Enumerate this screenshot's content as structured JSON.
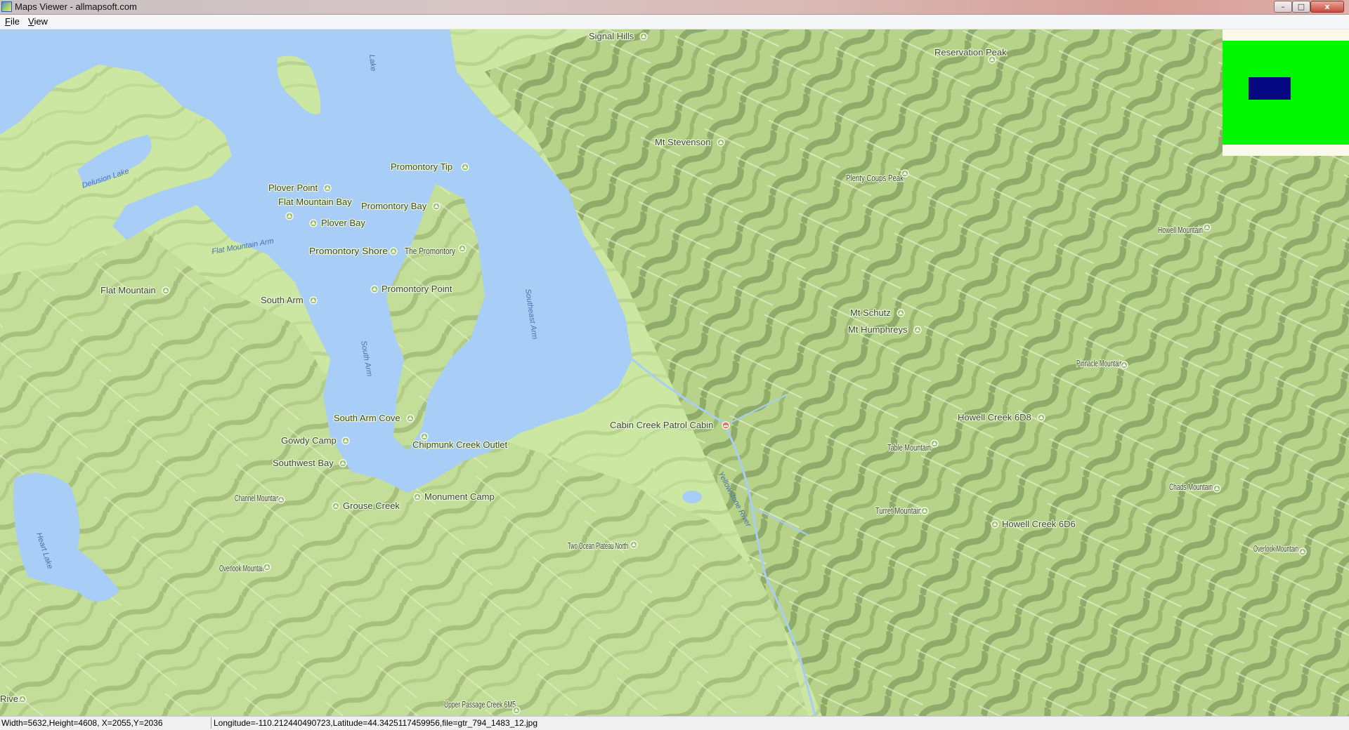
{
  "window": {
    "title": "Maps Viewer - allmapsoft.com",
    "buttons": {
      "minimize": "–",
      "maximize": "□",
      "close": "x"
    }
  },
  "menu": {
    "file": "File",
    "view": "View"
  },
  "map": {
    "water_labels": [
      "Delusion Lake",
      "Flat Mountain Arm",
      "South Arm",
      "Southeast Arm",
      "Heart Lake",
      "Lake",
      "Yellowstone River"
    ],
    "places": [
      "Signal Hills",
      "Reservation Peak",
      "Mt Stevenson",
      "Promontory Tip",
      "Plover Point",
      "Flat Mountain Bay",
      "Promontory Bay",
      "Plenty Coups Peak",
      "Plover Bay",
      "The Promontory",
      "Promontory Shore",
      "Howell Mountain",
      "Flat Mountain",
      "South Arm",
      "Promontory Point",
      "Mt Schutz",
      "Mt Humphreys",
      "Pinnacle Mountain",
      "Howell Creek 6D8",
      "Cabin Creek Patrol Cabin",
      "South Arm Cove",
      "Gowdy Camp",
      "Chipmunk Creek Outlet",
      "Table Mountain",
      "Southwest Bay",
      "Chads Mountain",
      "Channel Mountain",
      "Monument Camp",
      "Grouse Creek",
      "Turret Mountain",
      "Howell Creek 6D6",
      "Two Ocean Plateau North",
      "Overlook Mountain",
      "Overlook Mountain",
      "Upper Passage Creek 6M5",
      "River"
    ]
  },
  "status": {
    "dimensions": "Width=5632,Height=4608, X=2055,Y=2036",
    "coordinates": "Longitude=-110.212440490723,Latitude=44.3425117459956,file=gtr_794_1483_12.jpg"
  },
  "colors": {
    "water": "#a8cdf6",
    "land": "#cbe7a2",
    "overview_bg": "#00f700",
    "overview_rect": "#050a82"
  }
}
